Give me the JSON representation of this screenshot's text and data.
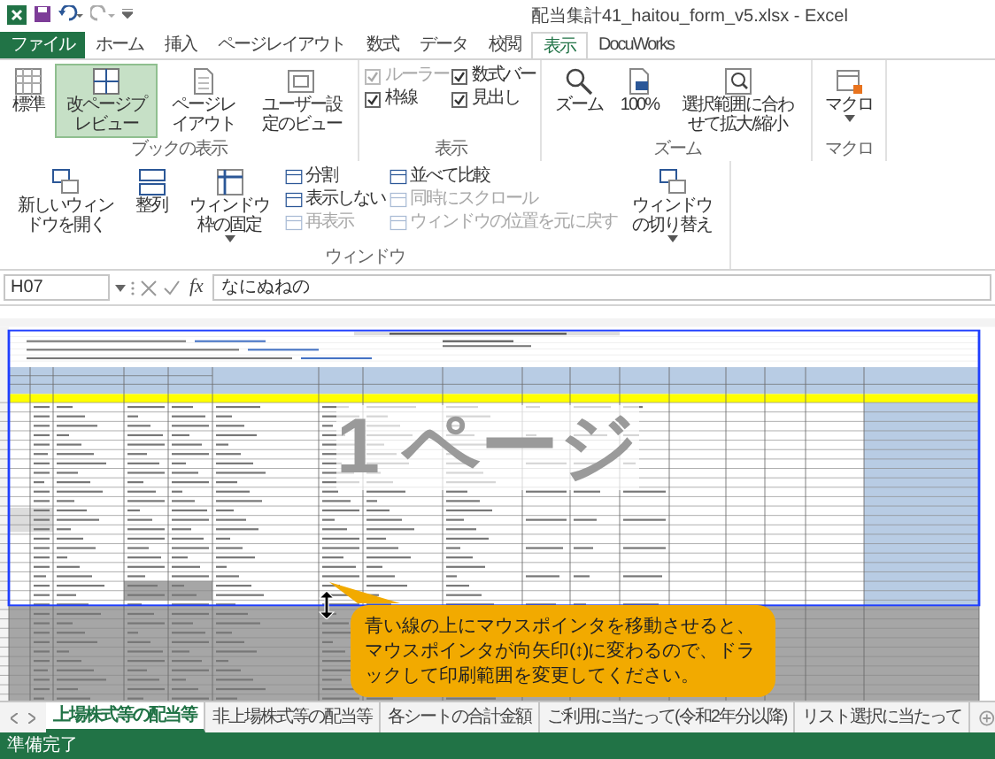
{
  "window": {
    "title": "配当集計41_haitou_form_v5.xlsx - Excel"
  },
  "menu_tabs": [
    {
      "label": "ファイル",
      "kind": "file",
      "selected": false
    },
    {
      "label": "ホーム",
      "kind": "tab",
      "selected": false
    },
    {
      "label": "挿入",
      "kind": "tab",
      "selected": false
    },
    {
      "label": "ページレイアウト",
      "kind": "tab",
      "selected": false
    },
    {
      "label": "数式",
      "kind": "tab",
      "selected": false
    },
    {
      "label": "データ",
      "kind": "tab",
      "selected": false
    },
    {
      "label": "校閲",
      "kind": "tab",
      "selected": false
    },
    {
      "label": "表示",
      "kind": "tab",
      "selected": true
    },
    {
      "label": "DocuWorks",
      "kind": "tab",
      "selected": false
    }
  ],
  "ribbon": {
    "groups": [
      {
        "label": "ブックの表示",
        "items": [
          {
            "kind": "large",
            "label": "標準",
            "selected": false
          },
          {
            "kind": "large",
            "label": "改ページプレビュー",
            "selected": true
          },
          {
            "kind": "large",
            "label": "ページレイアウト",
            "selected": false
          },
          {
            "kind": "large",
            "label": "ユーザー設定のビュー",
            "selected": false
          }
        ]
      },
      {
        "label": "表示",
        "items": [
          {
            "kind": "checkbox",
            "label": "ルーラー",
            "checked": true,
            "disabled": true
          },
          {
            "kind": "checkbox",
            "label": "枠線",
            "checked": true,
            "disabled": false
          },
          {
            "kind": "checkbox",
            "label": "数式バー",
            "checked": true,
            "disabled": false
          },
          {
            "kind": "checkbox",
            "label": "見出し",
            "checked": true,
            "disabled": false
          }
        ]
      },
      {
        "label": "ズーム",
        "items": [
          {
            "kind": "large",
            "label": "ズーム",
            "selected": false
          },
          {
            "kind": "large",
            "label": "100%",
            "selected": false
          },
          {
            "kind": "large",
            "label": "選択範囲に合わせて拡大/縮小",
            "selected": false
          }
        ]
      },
      {
        "label": "マクロ",
        "items": [
          {
            "kind": "large",
            "label": "マクロ",
            "selected": false,
            "dropdown": true
          }
        ]
      },
      {
        "label": "ウィンドウ",
        "items": [
          {
            "kind": "large",
            "label": "新しいウィンドウを開く",
            "selected": false
          },
          {
            "kind": "large",
            "label": "整列",
            "selected": false
          },
          {
            "kind": "large",
            "label": "ウィンドウ枠の固定",
            "selected": false,
            "dropdown": true
          },
          {
            "kind": "small",
            "label": "分割",
            "disabled": false
          },
          {
            "kind": "small",
            "label": "表示しない",
            "disabled": false
          },
          {
            "kind": "small",
            "label": "再表示",
            "disabled": true
          },
          {
            "kind": "small",
            "label": "並べて比較",
            "disabled": false
          },
          {
            "kind": "small",
            "label": "同時にスクロール",
            "disabled": true
          },
          {
            "kind": "small",
            "label": "ウィンドウの位置を元に戻す",
            "disabled": true
          },
          {
            "kind": "large",
            "label": "ウィンドウの切り替え",
            "selected": false,
            "dropdown": true
          }
        ]
      }
    ]
  },
  "formula_bar": {
    "name_box": "H07",
    "function_button": "fx",
    "value": "なにぬねの"
  },
  "sheet": {
    "page_label": "1 ページ"
  },
  "callout": {
    "text": "青い線の上にマウスポインタを移動させると、マウスポインタが向矢印(↕)に変わるので、ドラックして印刷範囲を変更してください。"
  },
  "sheet_tabs": [
    {
      "label": "上場株式等の配当等",
      "selected": true
    },
    {
      "label": "非上場株式等の配当等",
      "selected": false
    },
    {
      "label": "各シートの合計金額",
      "selected": false
    },
    {
      "label": "ご利用に当たって(令和2年分以降)",
      "selected": false
    },
    {
      "label": "リスト選択に当たって",
      "selected": false
    }
  ],
  "status_bar": {
    "text": "準備完了"
  }
}
